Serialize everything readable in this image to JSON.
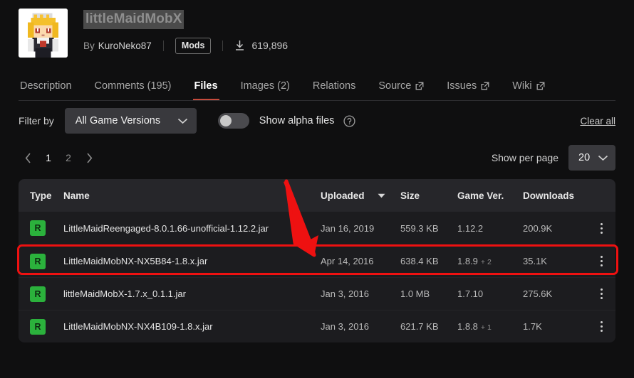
{
  "project": {
    "title": "littleMaidMobX",
    "by_label": "By",
    "author": "KuroNeko87",
    "category_badge": "Mods",
    "downloads": "619,896",
    "download_icon": "download-icon",
    "thumbnail_alt": "minecraft-maid-avatar"
  },
  "tabs": [
    {
      "label": "Description",
      "active": false,
      "external": false
    },
    {
      "label": "Comments (195)",
      "active": false,
      "external": false
    },
    {
      "label": "Files",
      "active": true,
      "external": false
    },
    {
      "label": "Images (2)",
      "active": false,
      "external": false
    },
    {
      "label": "Relations",
      "active": false,
      "external": false
    },
    {
      "label": "Source",
      "active": false,
      "external": true
    },
    {
      "label": "Issues",
      "active": false,
      "external": true
    },
    {
      "label": "Wiki",
      "active": false,
      "external": true
    }
  ],
  "filter": {
    "label": "Filter by",
    "game_version_selected": "All Game Versions",
    "game_version_icon": "chevron-down-icon",
    "alpha_toggle_label": "Show alpha files",
    "alpha_toggle_on": false,
    "help_icon": "question-circle-icon",
    "clear_all": "Clear all"
  },
  "pagination": {
    "prev_icon": "chevron-left-icon",
    "next_icon": "chevron-right-icon",
    "pages": [
      "1",
      "2"
    ],
    "current_page": "1",
    "per_page_label": "Show per page",
    "per_page_value": "20",
    "per_page_icon": "chevron-down-icon"
  },
  "table": {
    "headers": {
      "type": "Type",
      "name": "Name",
      "uploaded": "Uploaded",
      "sort_icon": "caret-down-icon",
      "size": "Size",
      "game_ver": "Game Ver.",
      "downloads": "Downloads"
    },
    "rows": [
      {
        "release_type": "R",
        "name": "LittleMaidReengaged-8.0.1.66-unofficial-1.12.2.jar",
        "uploaded": "Jan 16, 2019",
        "size": "559.3 KB",
        "game_ver": "1.12.2",
        "game_ver_extra": "",
        "downloads": "200.9K",
        "menu_icon": "kebab-menu-icon",
        "highlighted": true
      },
      {
        "release_type": "R",
        "name": "LittleMaidMobNX-NX5B84-1.8.x.jar",
        "uploaded": "Apr 14, 2016",
        "size": "638.4 KB",
        "game_ver": "1.8.9",
        "game_ver_extra": "+ 2",
        "downloads": "35.1K",
        "menu_icon": "kebab-menu-icon",
        "highlighted": false
      },
      {
        "release_type": "R",
        "name": "littleMaidMobX-1.7.x_0.1.1.jar",
        "uploaded": "Jan 3, 2016",
        "size": "1.0 MB",
        "game_ver": "1.7.10",
        "game_ver_extra": "",
        "downloads": "275.6K",
        "menu_icon": "kebab-menu-icon",
        "highlighted": false
      },
      {
        "release_type": "R",
        "name": "LittleMaidMobNX-NX4B109-1.8.x.jar",
        "uploaded": "Jan 3, 2016",
        "size": "621.7 KB",
        "game_ver": "1.8.8",
        "game_ver_extra": "+ 1",
        "downloads": "1.7K",
        "menu_icon": "kebab-menu-icon",
        "highlighted": false
      }
    ]
  },
  "annotations": {
    "arrow_color": "#ee1111",
    "highlight_box_color": "#ee1111",
    "arrow_name": "red-pointer-arrow",
    "box_name": "red-highlight-box"
  },
  "colors": {
    "page_bg": "#0f0f10",
    "table_header_bg": "#26262a",
    "row_bg": "#1c1c1f",
    "accent_tab": "#c64b3c",
    "release_badge": "#2bb13c"
  }
}
